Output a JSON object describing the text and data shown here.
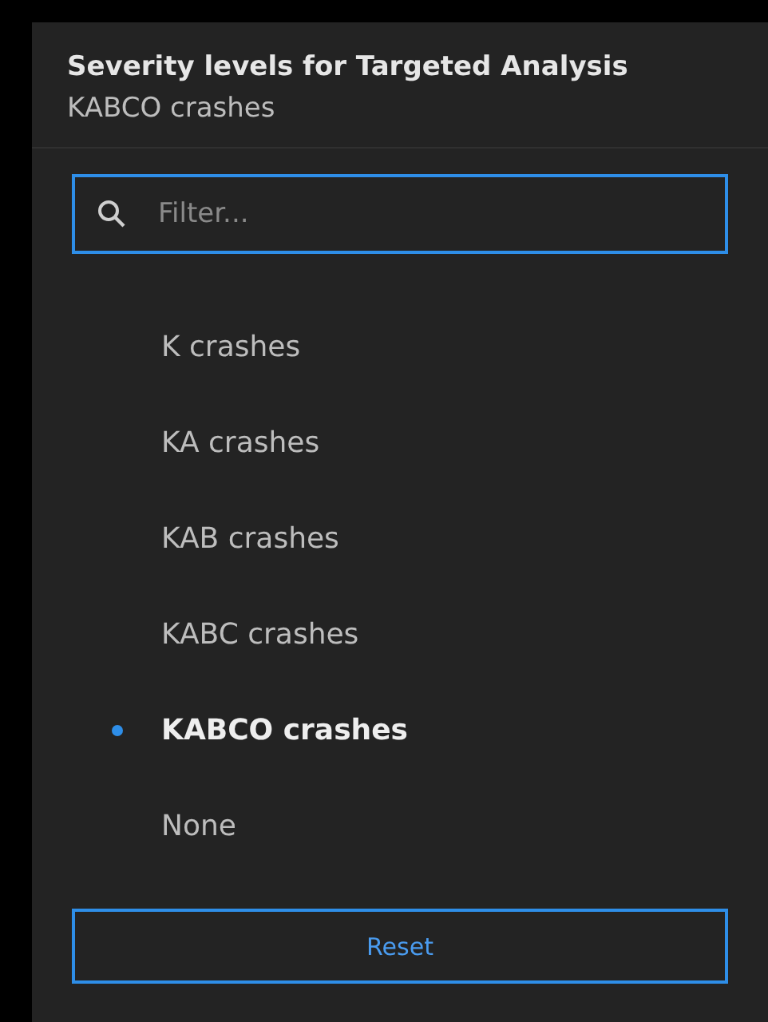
{
  "panel": {
    "title": "Severity levels for Targeted Analysis",
    "subtitle": "KABCO crashes"
  },
  "filter": {
    "placeholder": "Filter..."
  },
  "items": [
    {
      "label": "K crashes",
      "selected": false
    },
    {
      "label": "KA crashes",
      "selected": false
    },
    {
      "label": "KAB crashes",
      "selected": false
    },
    {
      "label": "KABC crashes",
      "selected": false
    },
    {
      "label": "KABCO crashes",
      "selected": true
    },
    {
      "label": "None",
      "selected": false
    }
  ],
  "reset_button": {
    "label": "Reset"
  }
}
